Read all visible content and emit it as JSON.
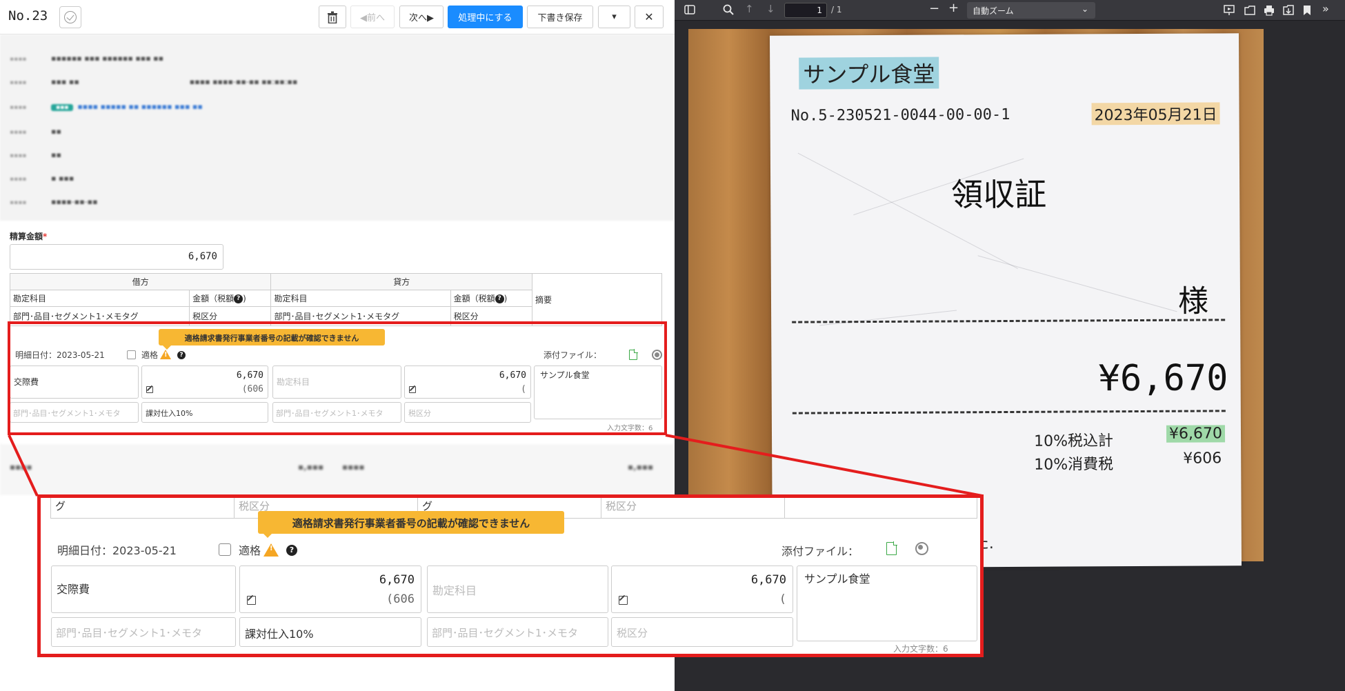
{
  "header": {
    "doc_no": "No.23",
    "prev_label": "◀前へ",
    "next_label": "次へ▶",
    "processing_label": "処理中にする",
    "draft_label": "下書き保存",
    "dropdown_label": "▾",
    "close_label": "✕"
  },
  "form": {
    "amount_label": "精算金額",
    "required_mark": "*",
    "amount_value": "6,670"
  },
  "ledger": {
    "debit_header": "借方",
    "credit_header": "貸方",
    "account_label": "勘定科目",
    "amount_tax_label": "金額（税額",
    "memo_label": "摘要",
    "dept_label": "部門･品目･セグメント1･メモタグ",
    "tax_label": "税区分"
  },
  "entry": {
    "date_label": "明細日付：2023-05-21",
    "eligible_label": "適格",
    "warning": "適格請求書発行事業者番号の記載が確認できません",
    "attach_label": "添付ファイル：",
    "debit_account": "交際費",
    "debit_amount": "6,670",
    "debit_tax": "(606",
    "credit_account_ph": "勘定科目",
    "credit_amount": "6,670",
    "credit_tax": "(",
    "memo": "サンプル食堂",
    "dept_ph": "部門･品目･セグメント1･メモタ",
    "tax_class": "課対仕入10%",
    "tax_ph": "税区分",
    "char_count": "入力文字数：6"
  },
  "zoom_top": {
    "cell_a": "グ",
    "cell_b": "税区分"
  },
  "pdf_viewer": {
    "page_current": "1",
    "page_total": "/ 1",
    "zoom_mode": "自動ズーム"
  },
  "receipt": {
    "store": "サンプル食堂",
    "number": "No.5-230521-0044-00-00-1",
    "date": "2023年05月21日",
    "title": "領収証",
    "honorific": "様",
    "total": "¥6,670",
    "tax_incl_label": "10%税込計",
    "tax_incl_value": "¥6,670",
    "tax_label": "10%消費税",
    "tax_value": "¥606",
    "tail": "た."
  },
  "colors": {
    "primary": "#1a8cff",
    "warning": "#f7b733",
    "highlight_red": "#e41d1d",
    "store_highlight": "#9fd3df",
    "date_highlight": "#f3d7a5",
    "amount_highlight": "#9fd9a8"
  }
}
